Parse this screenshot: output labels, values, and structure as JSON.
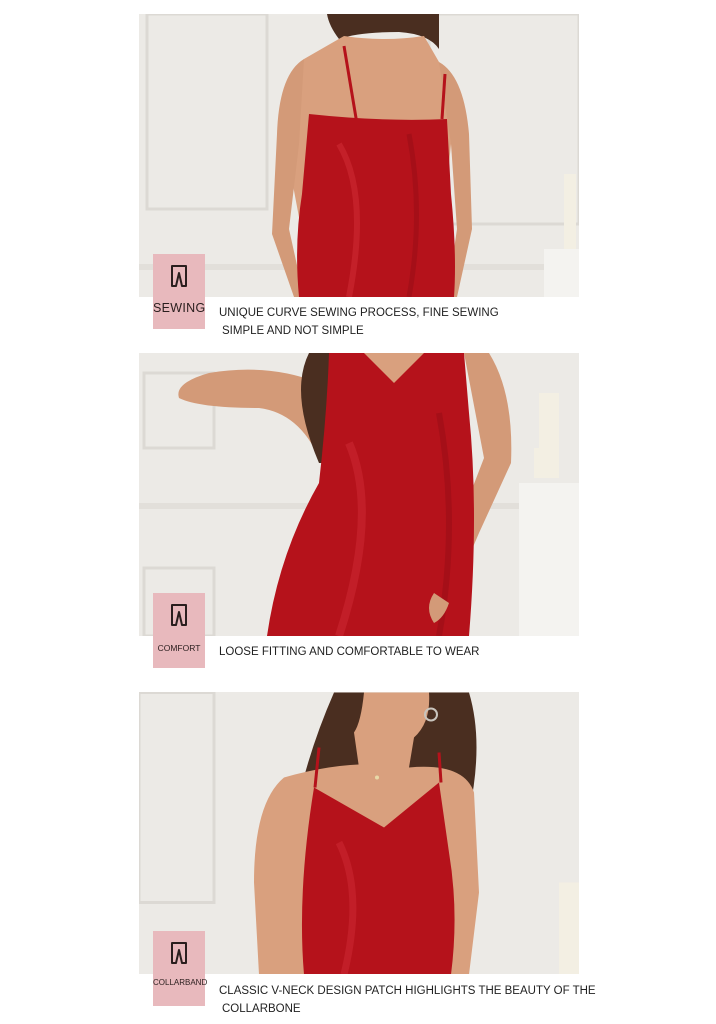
{
  "sections": [
    {
      "badge_icon": "trousers-icon",
      "badge_label": "SEWING",
      "line1": "UNIQUE CURVE SEWING PROCESS, FINE SEWING",
      "line2": "SIMPLE AND NOT SIMPLE"
    },
    {
      "badge_icon": "trousers-icon",
      "badge_label": "COMFORT",
      "line1": "LOOSE FITTING AND COMFORTABLE TO WEAR",
      "line2": ""
    },
    {
      "badge_icon": "trousers-icon",
      "badge_label": "COLLARBAND",
      "line1": "CLASSIC V-NECK DESIGN PATCH HIGHLIGHTS THE BEAUTY OF THE",
      "line2": "COLLARBONE"
    }
  ],
  "colors": {
    "dress": "#b5121b",
    "badge": "#e8b9bd",
    "wall": "#eceae6",
    "skin": "#d9a07e",
    "hair": "#4a2e20"
  }
}
